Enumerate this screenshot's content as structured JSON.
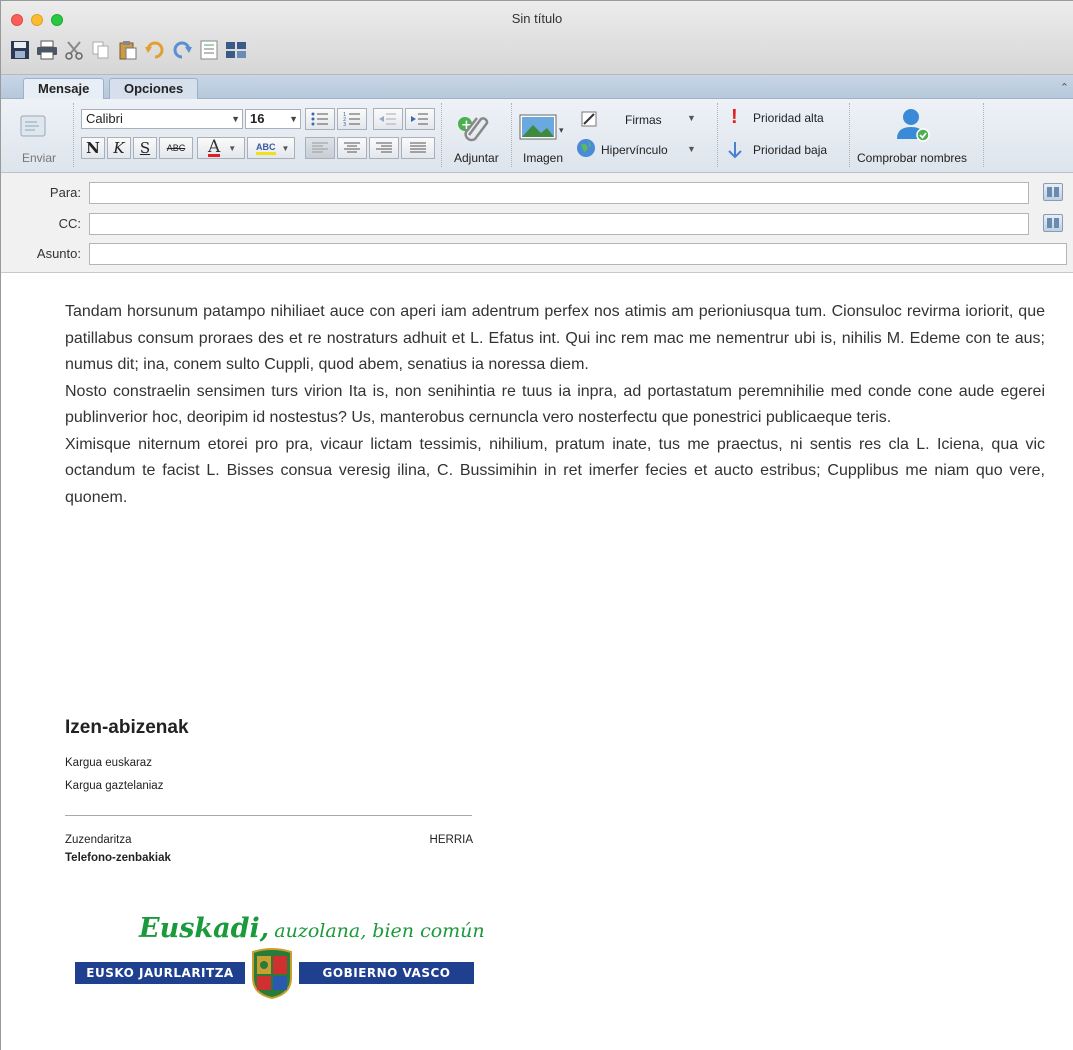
{
  "window": {
    "title": "Sin título"
  },
  "quick_access": [
    "save-icon",
    "print-icon",
    "cut-icon",
    "copy-icon",
    "paste-icon",
    "undo-icon",
    "redo-icon",
    "format-icon",
    "grid-icon"
  ],
  "tabs": [
    {
      "label": "Mensaje",
      "active": true
    },
    {
      "label": "Opciones",
      "active": false
    }
  ],
  "ribbon": {
    "send_label": "Enviar",
    "font_name": "Calibri",
    "font_size": "16",
    "bold": "N",
    "italic": "K",
    "underline": "S",
    "strike": "ABC",
    "font_color": "A",
    "highlight": "ABC",
    "attach_label": "Adjuntar",
    "image_label": "Imagen",
    "signatures_label": "Firmas",
    "hyperlink_label": "Hipervínculo",
    "priority_high_label": "Prioridad alta",
    "priority_low_label": "Prioridad baja",
    "check_names_label": "Comprobar nombres"
  },
  "address": {
    "to_label": "Para:",
    "to_value": "",
    "cc_label": "CC:",
    "cc_value": "",
    "subject_label": "Asunto:",
    "subject_value": ""
  },
  "body": {
    "paragraphs": [
      "Tandam horsunum patampo nihiliaet auce con aperi iam adentrum perfex nos atimis am perioniusqua tum. Cionsuloc revirma ioriorit, que patillabus consum proraes des et re nostraturs adhuit et L. Efatus int. Qui inc rem mac me nementrur ubi is, nihilis M. Edeme con te aus; numus dit; ina, conem sulto Cuppli, quod abem, senatius ia noressa diem.",
      "Nosto constraelin sensimen turs virion Ita is, non senihintia re tuus ia inpra, ad portastatum peremnihilie med conde cone aude egerei publinverior hoc, deoripim id nostestus? Us, manterobus cernuncla vero nosterfectu que ponestrici publicaeque teris.",
      "Ximisque niternum etorei pro pra, vicaur lictam tessimis, nihilium, pratum inate, tus me praectus, ni sentis res cla L. Iciena, qua vic octandum te facist L. Bisses consua veresig ilina, C. Bussimihin in ret imerfer fecies et aucto estribus; Cupplibus me niam quo vere, quonem."
    ]
  },
  "signature": {
    "name": "Izen-abizenak",
    "role_eu": "Kargua euskaraz",
    "role_es": "Kargua gaztelaniaz",
    "department": "Zuzendaritza",
    "town": "HERRIA",
    "phones": "Telefono-zenbakiak",
    "slogan_main": "Euskadi,",
    "slogan_rest": "auzolana, bien común",
    "logo_left": "EUSKO JAURLARITZA",
    "logo_right": "GOBIERNO VASCO"
  },
  "colors": {
    "accent_blue": "#1f3f8f",
    "slogan_green": "#1a9a3a",
    "traffic_red": "#fc5f57",
    "traffic_yellow": "#fdbc2e",
    "traffic_green": "#28c840"
  }
}
